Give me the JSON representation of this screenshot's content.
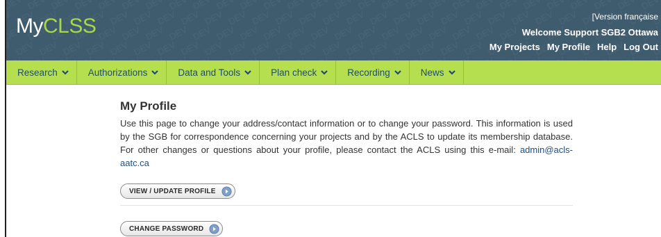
{
  "header": {
    "logo_my": "My",
    "logo_clss": "CLSS",
    "version_link": "[Version française",
    "welcome": "Welcome Support SGB2 Ottawa",
    "watermark": "DEV",
    "links": [
      "My Projects",
      "My Profile",
      "Help",
      "Log Out"
    ]
  },
  "nav": {
    "items": [
      "Research",
      "Authorizations",
      "Data and Tools",
      "Plan check",
      "Recording",
      "News"
    ]
  },
  "main": {
    "title": "My Profile",
    "intro": "Use this page to change your address/contact information or to change your password. This information is used by the SGB for correspondence concerning your projects and by the ACLS to update its membership database. For other changes or questions about your profile, please contact the ACLS using this e-mail:",
    "email": "admin@acls-aatc.ca",
    "view_button": "VIEW / UPDATE PROFILE",
    "password_button": "CHANGE PASSWORD"
  },
  "colors": {
    "header_bg": "#3f5b6e",
    "nav_bg": "#b6df50",
    "logo_accent": "#a6d84a",
    "nav_text": "#1f4d6d"
  },
  "icons": [
    "chevron-down-icon",
    "arrow-right-circle-icon"
  ]
}
